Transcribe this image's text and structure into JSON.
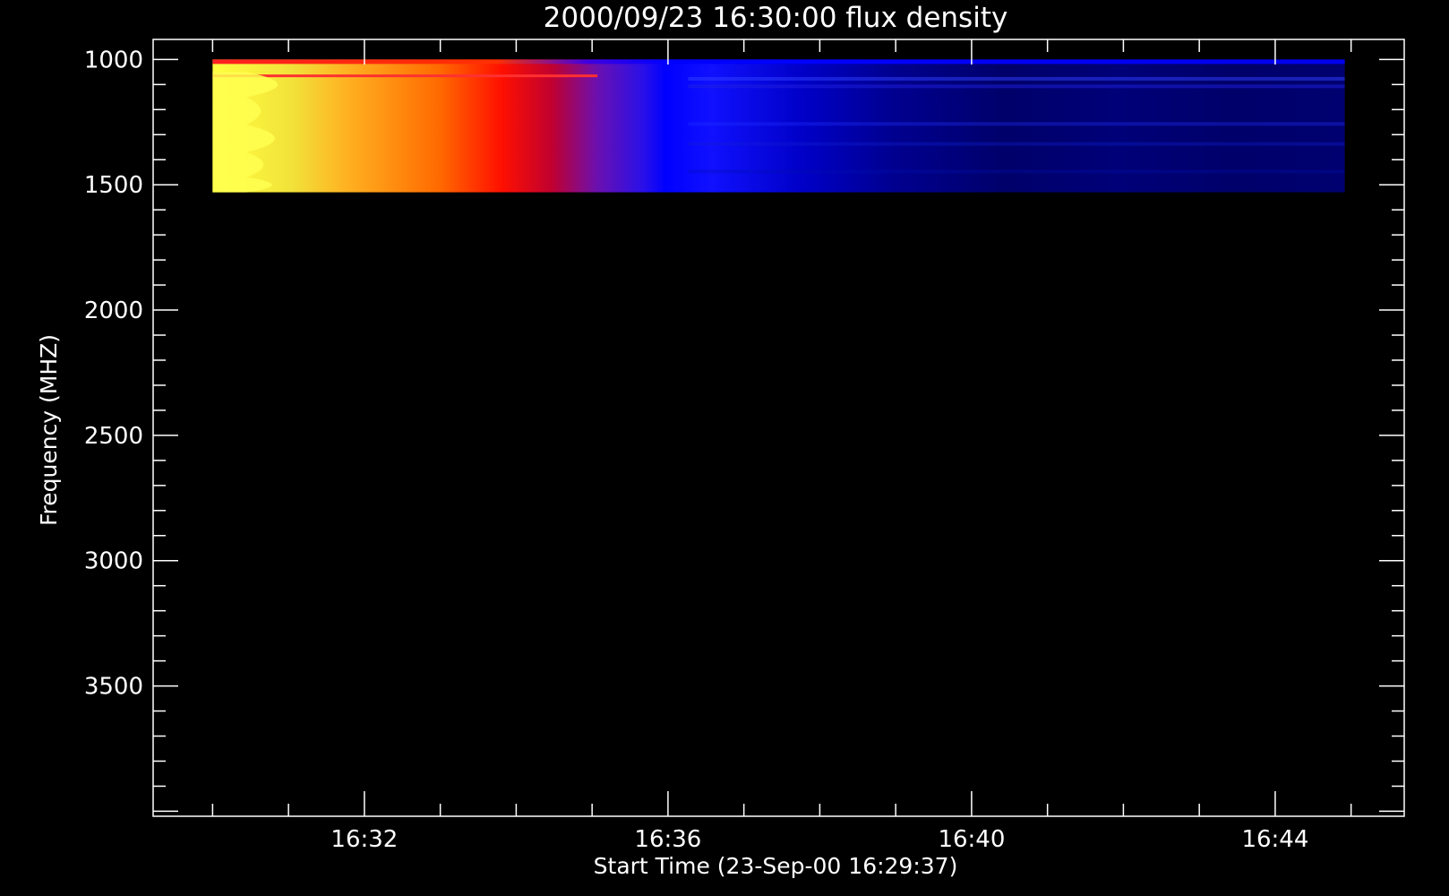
{
  "chart_data": {
    "type": "heatmap",
    "title": "2000/09/23 16:30:00 flux density",
    "xlabel": "Start Time (23-Sep-00 16:29:37)",
    "ylabel": "Frequency (MHZ)",
    "x_axis": {
      "unit": "time",
      "range": [
        "16:29:13",
        "16:45:42"
      ],
      "major_ticks": [
        "16:32",
        "16:36",
        "16:40",
        "16:44"
      ],
      "minor_tick_interval_minutes": 1
    },
    "y_axis": {
      "unit": "MHz",
      "reversed": true,
      "range": [
        920,
        4020
      ],
      "major_ticks": [
        "1000",
        "1500",
        "2000",
        "2500",
        "3000",
        "3500"
      ],
      "minor_tick_interval": 100
    },
    "data_extent": {
      "time_start": "16:30:00",
      "time_end": "16:44:55",
      "freq_min": 1000,
      "freq_max": 1530
    },
    "colormap": [
      "#000000",
      "#0000ff",
      "#ff0000",
      "#ffa500",
      "#ffff40"
    ],
    "grid": false,
    "legend": "none"
  }
}
